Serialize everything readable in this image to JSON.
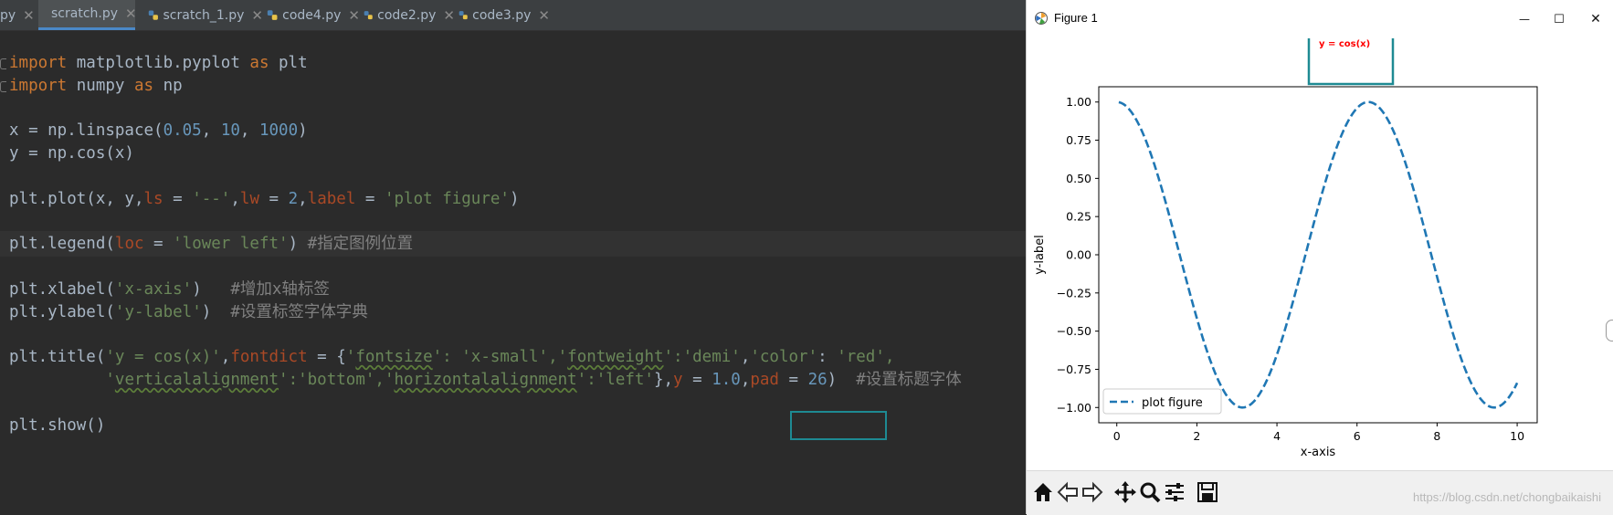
{
  "ide": {
    "tabs": [
      {
        "label": "py",
        "active": false
      },
      {
        "label": "scratch.py",
        "active": true
      },
      {
        "label": "scratch_1.py",
        "active": false
      },
      {
        "label": "code4.py",
        "active": false
      },
      {
        "label": "code2.py",
        "active": false
      },
      {
        "label": "code3.py",
        "active": false
      }
    ],
    "code": {
      "l1": [
        "import",
        " matplotlib.pyplot ",
        "as",
        " plt"
      ],
      "l2": [
        "import",
        " numpy ",
        "as",
        " np"
      ],
      "l4": [
        "x = np.linspace(",
        "0.05",
        ", ",
        "10",
        ", ",
        "1000",
        ")"
      ],
      "l5": [
        "y = np.cos(x)"
      ],
      "l7": [
        "plt.plot(x, y,",
        "ls",
        " = ",
        "'--'",
        ",",
        "lw",
        " = ",
        "2",
        ",",
        "label",
        " = ",
        "'plot figure'",
        ")"
      ],
      "l9": [
        "plt.legend(",
        "loc",
        " = ",
        "'lower left'",
        ") ",
        "#指定图例位置"
      ],
      "l11": [
        "plt.xlabel(",
        "'x-axis'",
        ")   ",
        "#增加x轴标签"
      ],
      "l12": [
        "plt.ylabel(",
        "'y-label'",
        ")  ",
        "#设置标签字体字典"
      ],
      "l14": [
        "plt.title(",
        "'y = cos(x)'",
        ",",
        "fontdict",
        " = {",
        "'",
        "fontsize",
        "': ",
        "'x-small'",
        ",'",
        "fontweight",
        "':",
        "'demi'",
        ",",
        "'color'",
        ": ",
        "'red'",
        ","
      ],
      "l15": [
        "          ",
        "'",
        "verticalalignment",
        "':",
        "'bottom'",
        ",'",
        "horizontalalignment",
        "':",
        "'left'",
        "},",
        "y",
        " = ",
        "1.0",
        ",",
        "pad",
        " = ",
        "26",
        ")  ",
        "#设置标题字体"
      ],
      "l17": [
        "plt.show()"
      ]
    }
  },
  "figure": {
    "window_title": "Figure 1",
    "minimize": "—",
    "maximize": "☐",
    "close": "✕",
    "watermark": "https://blog.csdn.net/chongbaikaishi"
  },
  "chart_data": {
    "type": "line",
    "title": "y = cos(x)",
    "title_color": "#ff0000",
    "xlabel": "x-axis",
    "ylabel": "y-label",
    "xlim": [
      -0.45,
      10.5
    ],
    "ylim": [
      -1.1,
      1.1
    ],
    "xticks": [
      "0",
      "2",
      "4",
      "6",
      "8",
      "10"
    ],
    "yticks": [
      "−1.00",
      "−0.75",
      "−0.50",
      "−0.25",
      "0.00",
      "0.25",
      "0.50",
      "0.75",
      "1.00"
    ],
    "legend_position": "lower left",
    "grid": false,
    "series": [
      {
        "name": "plot figure",
        "function": "cos",
        "x_start": 0.05,
        "x_end": 10,
        "line_style": "dashed",
        "color": "#1f77b4"
      }
    ]
  },
  "colors": {
    "accent_box": "#1e8a93"
  }
}
